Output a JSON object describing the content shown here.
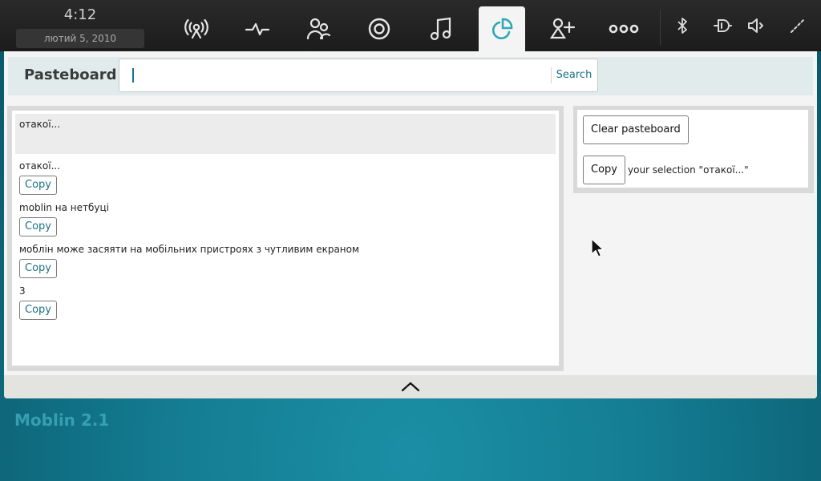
{
  "clock": {
    "time": "4:12",
    "date": "лютий  5, 2010"
  },
  "toolbar": {
    "buttons": [
      {
        "icon": "wireless-status-icon"
      },
      {
        "icon": "pulse-icon"
      },
      {
        "icon": "people-icon"
      },
      {
        "icon": "target-icon"
      },
      {
        "icon": "music-note-icon"
      },
      {
        "icon": "pasteboard-icon",
        "active": true
      },
      {
        "icon": "add-person-icon"
      },
      {
        "icon": "applications-icon"
      }
    ],
    "tray": [
      "bluetooth-icon",
      "power-plug-icon",
      "volume-icon",
      "expand-icon"
    ],
    "accent": "#2fa7b5"
  },
  "panel": {
    "title": "Pasteboard",
    "search": {
      "value": "",
      "button": "Search"
    }
  },
  "list": {
    "selected": "отакої...",
    "items": [
      {
        "text": "отакої...",
        "copy": "Copy"
      },
      {
        "text": "moblin на нетбуці",
        "copy": "Copy"
      },
      {
        "text": "моблін може засяяти на мобільних пристроях з чутливим екраном",
        "copy": "Copy"
      },
      {
        "text": "3",
        "copy": "Copy"
      }
    ]
  },
  "actions": {
    "clear": "Clear pasteboard",
    "copy": "Copy",
    "selection": "your selection \"отакої...\""
  },
  "desktop": {
    "label": "Moblin 2.1"
  },
  "colors": {
    "link": "#1b7182",
    "desktop": "#147d93"
  }
}
